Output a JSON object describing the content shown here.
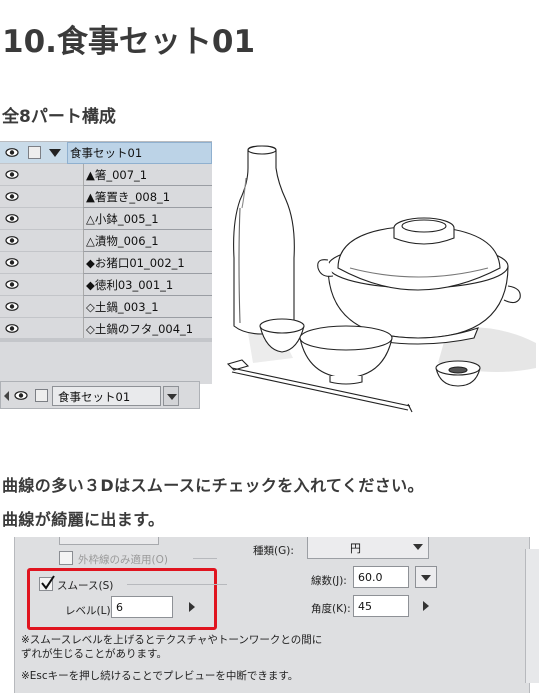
{
  "page": {
    "title": "10.食事セット01",
    "subtitle": "全8パート構成",
    "body_line1": "曲線の多い３Dはスムースにチェックを入れてください。",
    "body_line2": "曲線が綺麗に出ます。"
  },
  "layers": {
    "folder": "食事セット01",
    "items": [
      "▲箸_007_1",
      "▲箸置き_008_1",
      "△小鉢_005_1",
      "△漬物_006_1",
      "◆お猪口01_002_1",
      "◆徳利03_001_1",
      "◇土鍋_003_1",
      "◇土鍋のフタ_004_1"
    ],
    "bottom_label": "食事セット01"
  },
  "dialog": {
    "outer_only_label": "外枠線のみ適用(O)",
    "smooth_label": "スムース(S)",
    "smooth_checked": true,
    "level_label": "レベル(L):",
    "level_value": "6",
    "type_label": "種類(G):",
    "type_value": "円",
    "lines_label": "線数(J):",
    "lines_value": "60.0",
    "angle_label": "角度(K):",
    "angle_value": "45",
    "note1_line1": "※スムースレベルを上げるとテクスチャやトーンワークとの間に",
    "note1_line2": "ずれが生じることがあります。",
    "note2": "※Escキーを押し続けることでプレビューを中断できます。",
    "highlight_color": "#e0141f"
  }
}
